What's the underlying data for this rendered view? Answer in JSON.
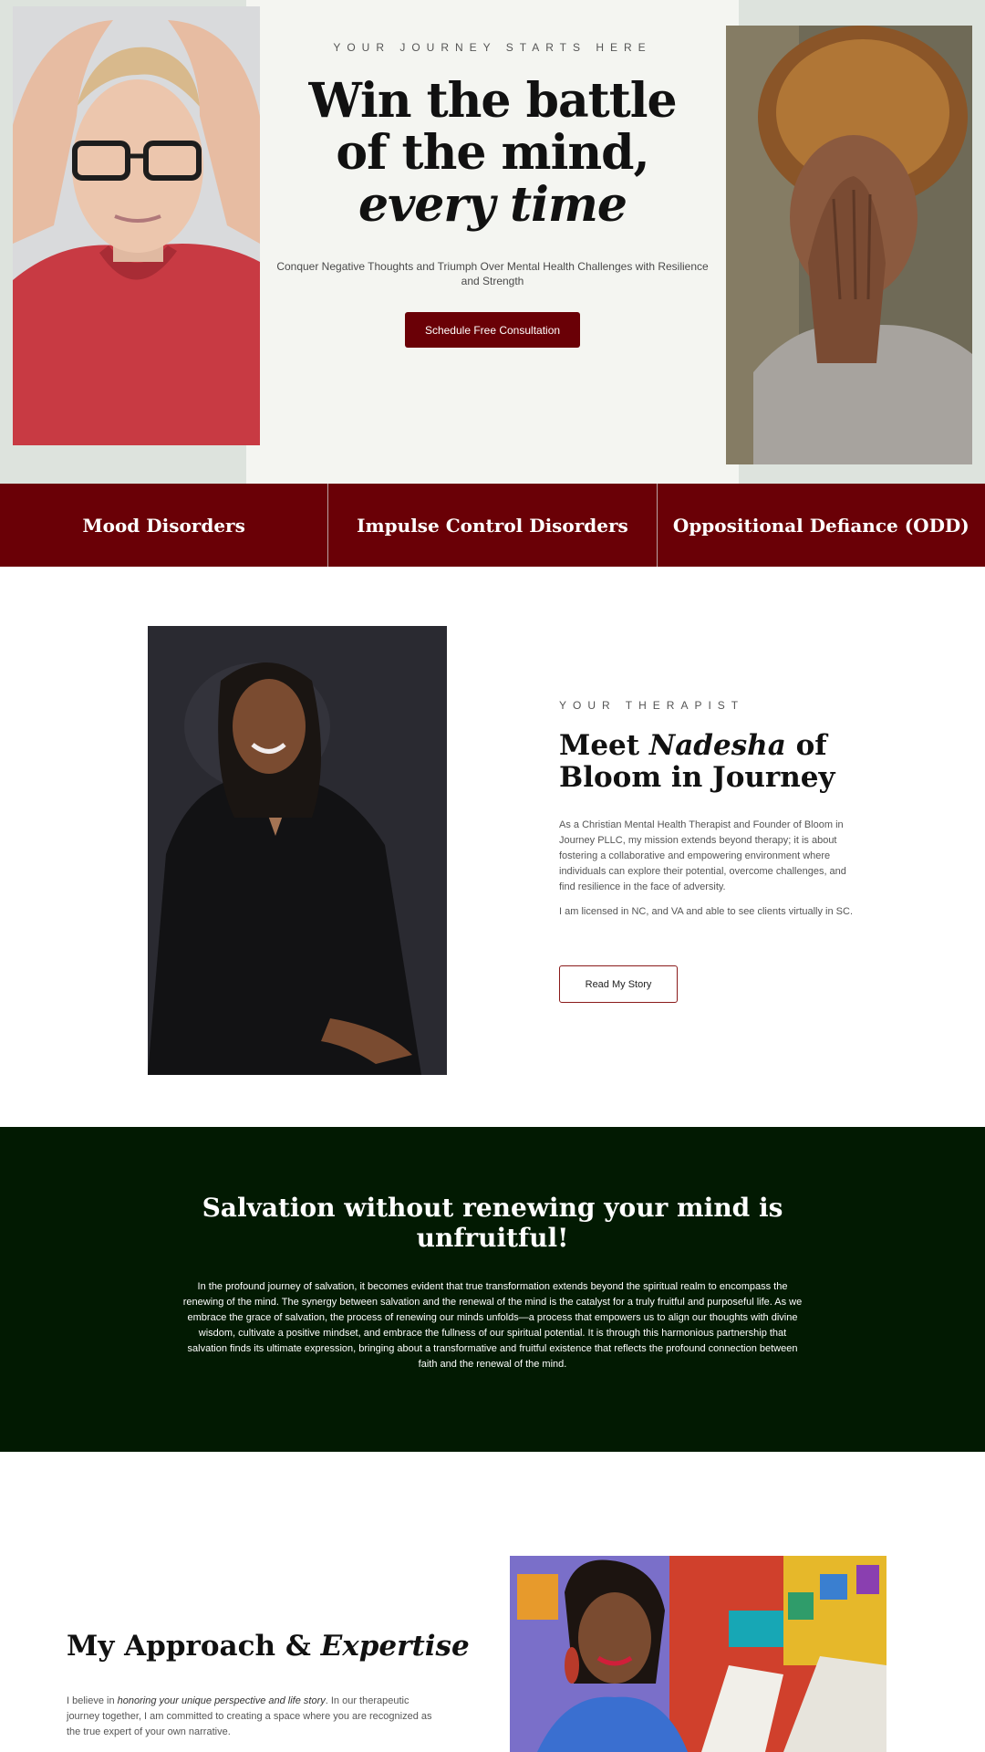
{
  "hero": {
    "eyebrow": "YOUR JOURNEY STARTS HERE",
    "title_line1": "Win the battle",
    "title_line2": "of the mind,",
    "title_line3": "every time",
    "subtitle": "Conquer Negative Thoughts and Triumph Over Mental Health Challenges with Resilience and Strength",
    "cta_label": "Schedule Free Consultation"
  },
  "specialties": [
    "Mood Disorders",
    "Impulse Control Disorders",
    "Oppositional Defiance (ODD)"
  ],
  "therapist": {
    "eyebrow": "YOUR THERAPIST",
    "title_pre": "Meet ",
    "title_name": "Nadesha",
    "title_post": " of Bloom in Journey",
    "paragraph1": "As a Christian Mental Health Therapist and Founder of Bloom in Journey PLLC, my mission extends beyond therapy; it is about fostering a collaborative and empowering environment where individuals can explore their potential, overcome challenges, and find resilience in the face of adversity.",
    "paragraph2": "I am licensed in NC, and VA and able to see clients virtually in SC.",
    "cta_label": "Read My Story"
  },
  "salvation": {
    "title": "Salvation without renewing your mind is unfruitful!",
    "body": "In the profound journey of salvation, it becomes evident that true transformation extends beyond the spiritual realm to encompass the renewing of the mind. The synergy between salvation and the renewal of the mind is the catalyst for a truly fruitful and purposeful life. As we embrace the grace of salvation, the process of renewing our minds unfolds—a process that empowers us to align our thoughts with divine wisdom, cultivate a positive mindset, and embrace the fullness of our spiritual potential. It is through this harmonious partnership that salvation finds its ultimate expression, bringing about a transformative and fruitful existence that reflects the profound connection between faith and the renewal of the mind."
  },
  "approach": {
    "title_pre": "My Approach & ",
    "title_italic": "Expertise",
    "body_pre": "I believe in ",
    "body_em": "honoring your unique perspective and life story",
    "body_post": ". In our therapeutic journey together, I am committed to creating a space where you are recognized as the true expert of your own narrative."
  },
  "colors": {
    "accent_maroon": "#6a0006",
    "dark_green": "#021a02",
    "hero_bg": "#f4f5f1",
    "hero_side_bg": "#dde3dd"
  }
}
